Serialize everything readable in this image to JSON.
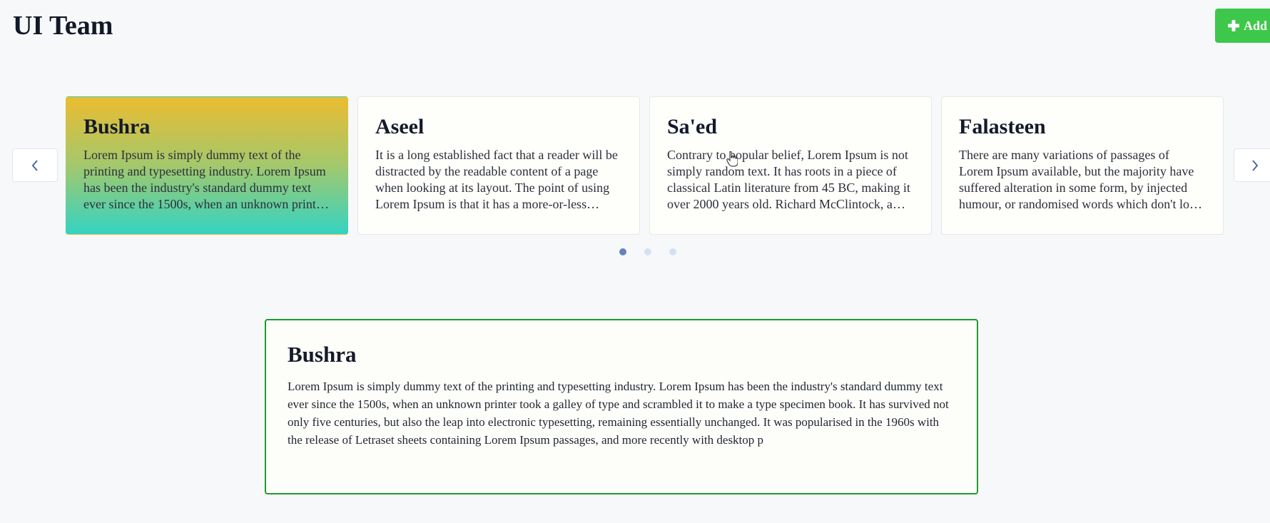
{
  "header": {
    "title": "UI Team",
    "add_label": "Add"
  },
  "carousel": {
    "cards": [
      {
        "name": "Bushra",
        "text": "Lorem Ipsum is simply dummy text of the printing and typesetting industry. Lorem Ipsum has been the industry's standard dummy text ever since the 1500s, when an unknown printer took a galley of type and scrambled it to make a type specimen book."
      },
      {
        "name": "Aseel",
        "text": "It is a long established fact that a reader will be distracted by the readable content of a page when looking at its layout. The point of using Lorem Ipsum is that it has a more-or-less normal distribution of letters."
      },
      {
        "name": "Sa'ed",
        "text": "Contrary to popular belief, Lorem Ipsum is not simply random text. It has roots in a piece of classical Latin literature from 45 BC, making it over 2000 years old. Richard McClintock, a Latin professor."
      },
      {
        "name": "Falasteen",
        "text": "There are many variations of passages of Lorem Ipsum available, but the majority have suffered alteration in some form, by injected humour, or randomised words which don't look even slightly believable."
      }
    ],
    "active_index": 0,
    "page_count": 3,
    "current_page": 1
  },
  "detail": {
    "name": "Bushra",
    "text": "Lorem Ipsum is simply dummy text of the printing and typesetting industry. Lorem Ipsum has been the industry's standard dummy text ever since the 1500s, when an unknown printer took a galley of type and scrambled it to make a type specimen book. It has survived not only five centuries, but also the leap into electronic typesetting, remaining essentially unchanged. It was popularised in the 1960s with the release of Letraset sheets containing Lorem Ipsum passages, and more recently with desktop p"
  },
  "colors": {
    "accent_green": "#3ec84b",
    "panel_border": "#1f9b2c",
    "dot_active": "#6384bf",
    "dot_inactive": "#d6e0f3"
  },
  "icons": {
    "add": "plus-icon",
    "prev": "chevron-left-icon",
    "next": "chevron-right-icon",
    "pointer": "hand-pointer-icon"
  }
}
